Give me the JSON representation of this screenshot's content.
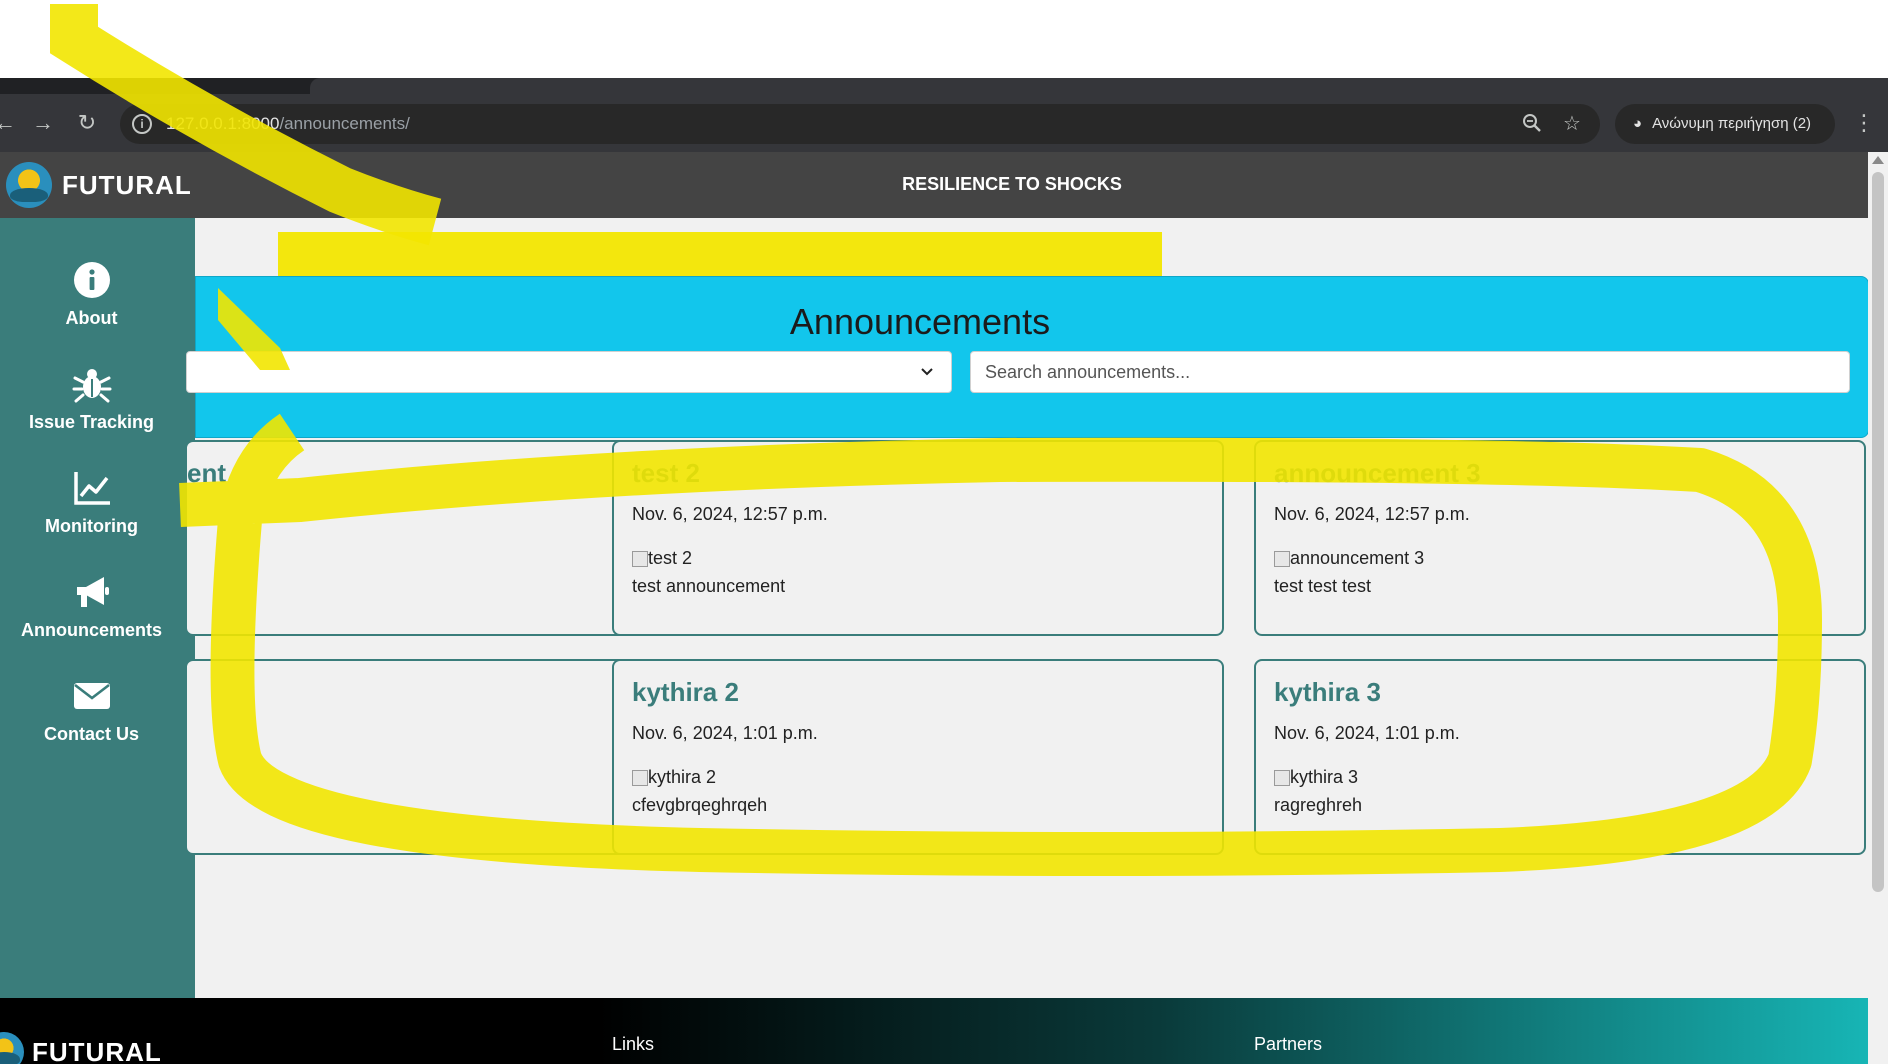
{
  "browser": {
    "url_host": "127.0.0.1:8000",
    "url_path": "/announcements/",
    "incognito_label": "Ανώνυμη περιήγηση (2)",
    "icons": [
      "back-icon",
      "forward-icon",
      "reload-icon",
      "site-info-icon",
      "zoom-icon",
      "bookmark-star-icon",
      "incognito-icon",
      "menu-dots-icon"
    ]
  },
  "header": {
    "logo_text": "FUTURAL",
    "title": "RESILIENCE TO SHOCKS"
  },
  "sidebar": {
    "items": [
      {
        "label": "About",
        "icon": "info-icon"
      },
      {
        "label": "Issue Tracking",
        "icon": "bug-icon"
      },
      {
        "label": "Monitoring",
        "icon": "chart-line-icon"
      },
      {
        "label": "Announcements",
        "icon": "megaphone-icon"
      },
      {
        "label": "Contact Us",
        "icon": "envelope-icon"
      }
    ]
  },
  "main": {
    "banner_title": "Announcements",
    "search_placeholder": "Search announcements...",
    "cards": [
      {
        "title": "ent",
        "date": "",
        "image_alt": "",
        "body": ""
      },
      {
        "title": "test 2",
        "date": "Nov. 6, 2024, 12:57 p.m.",
        "image_alt": "test 2",
        "body": "test announcement"
      },
      {
        "title": "announcement 3",
        "date": "Nov. 6, 2024, 12:57 p.m.",
        "image_alt": "announcement 3",
        "body": "test test test"
      },
      {
        "title": "",
        "date": "",
        "image_alt": "",
        "body": ""
      },
      {
        "title": "kythira 2",
        "date": "Nov. 6, 2024, 1:01 p.m.",
        "image_alt": "kythira 2",
        "body": "cfevgbrqeghrqeh"
      },
      {
        "title": "kythira 3",
        "date": "Nov. 6, 2024, 1:01 p.m.",
        "image_alt": "kythira 3",
        "body": "ragreghreh"
      }
    ]
  },
  "footer": {
    "logo_text": "FUTURAL",
    "links_heading": "Links",
    "partners_heading": "Partners"
  },
  "colors": {
    "sidebar": "#3a7d7b",
    "banner": "#12c6ec",
    "header": "#444444",
    "card_title": "#3a7d7b",
    "annotation_marker": "#f2e600"
  }
}
